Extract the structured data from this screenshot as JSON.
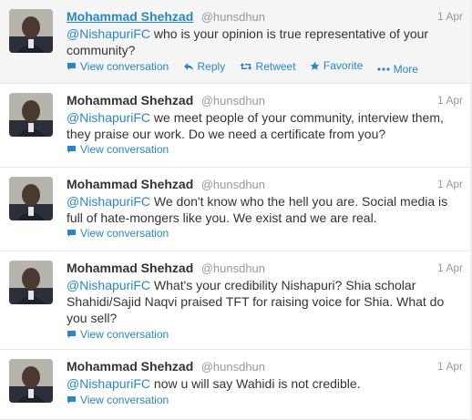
{
  "tweets": [
    {
      "fullname": "Mohammad Shehzad",
      "username": "@hunsdhun",
      "time": "1 Apr",
      "mention": "@NishapuriFC",
      "text": "who is your opinion is true representative of your community?",
      "view_conversation": "View conversation",
      "reply": "Reply",
      "retweet": "Retweet",
      "favorite": "Favorite",
      "more": "More"
    },
    {
      "fullname": "Mohammad Shehzad",
      "username": "@hunsdhun",
      "time": "1 Apr",
      "mention": "@NishapuriFC",
      "text": "we meet people of your community, interview them, they praise our work. Do we need a certificate from you?",
      "view_conversation": "View conversation"
    },
    {
      "fullname": "Mohammad Shehzad",
      "username": "@hunsdhun",
      "time": "1 Apr",
      "mention": "@NishapuriFC",
      "text": "We don't know who the hell you are. Social media is full of hate-mongers like you. We exist and we are real.",
      "view_conversation": "View conversation"
    },
    {
      "fullname": "Mohammad Shehzad",
      "username": "@hunsdhun",
      "time": "1 Apr",
      "mention": "@NishapuriFC",
      "text": "What's your credibility Nishapuri? Shia scholar Shahidi/Sajid Naqvi praised TFT for raising voice for Shia. What do you sell?",
      "view_conversation": "View conversation"
    },
    {
      "fullname": "Mohammad Shehzad",
      "username": "@hunsdhun",
      "time": "1 Apr",
      "mention": "@NishapuriFC",
      "text": "now u will say Wahidi is not credible.",
      "view_conversation": "View conversation"
    }
  ],
  "colors": {
    "link": "#2a86c8",
    "name": "#333333",
    "meta": "#999999",
    "hover_bg": "#f5f5f5"
  },
  "icons": {
    "conversation": "speech-bubble-icon",
    "reply": "reply-arrow-icon",
    "retweet": "retweet-icon",
    "favorite": "star-icon",
    "more": "ellipsis-icon"
  }
}
